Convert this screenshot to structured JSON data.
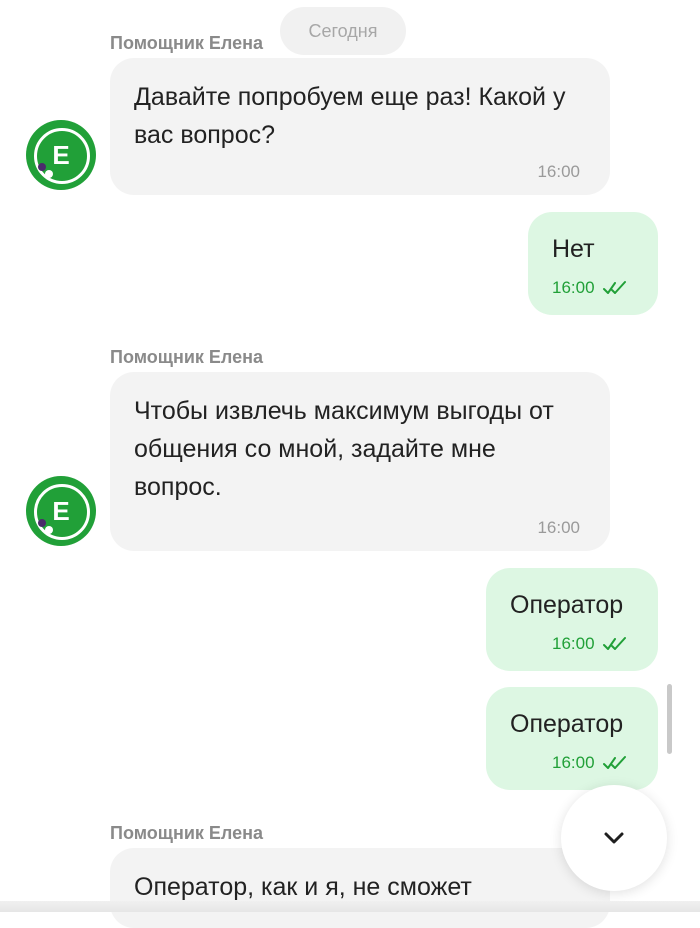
{
  "date_separator": "Сегодня",
  "messages": [
    {
      "sender": "Помощник Елена",
      "avatar_letter": "Е",
      "text": "Давайте попробуем еще раз! Какой у вас вопрос?",
      "time": "16:00"
    },
    {
      "text": "Нет",
      "time": "16:00",
      "read": true
    },
    {
      "sender": "Помощник Елена",
      "avatar_letter": "Е",
      "text": "Чтобы извлечь максимум выгоды от общения со мной, задайте мне вопрос.",
      "time": "16:00"
    },
    {
      "text": "Оператор",
      "time": "16:00",
      "read": true
    },
    {
      "text": "Оператор",
      "time": "16:00",
      "read": true
    },
    {
      "sender": "Помощник Елена",
      "text": "Оператор, как и я, не сможет"
    }
  ],
  "colors": {
    "brand_green": "#21a038",
    "outgoing_bubble": "#ddf7e3",
    "incoming_bubble": "#f3f3f3"
  },
  "icons": {
    "read_status": "double-check-icon",
    "scroll_down": "chevron-down-icon"
  }
}
